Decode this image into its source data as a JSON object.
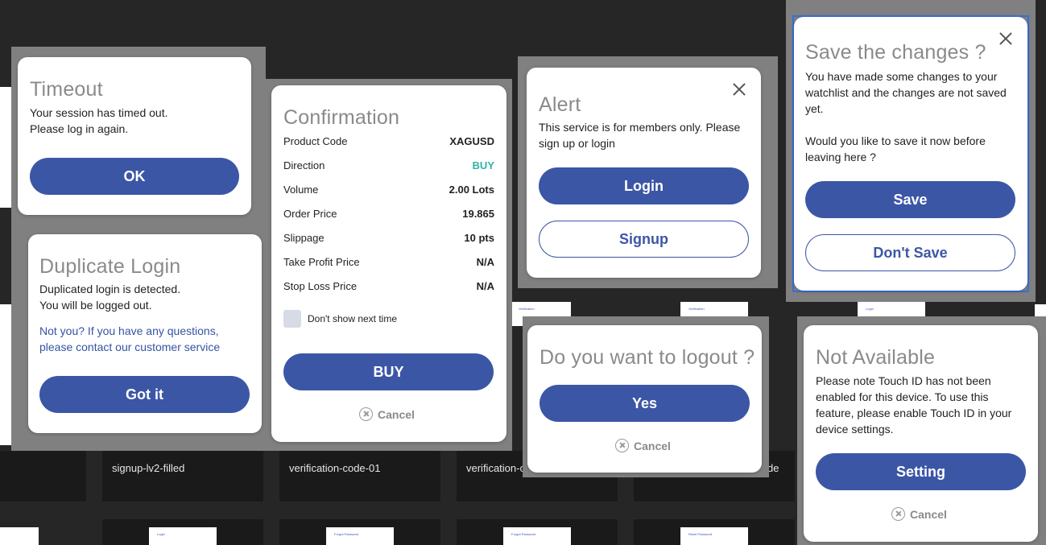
{
  "canvas": {
    "thumb_labels": [
      "signup-lv2-filled",
      "verification-code-01",
      "verification-c",
      "de"
    ],
    "mini_labels": [
      "Login",
      "Forgot Password",
      "Forgot Password",
      "Reset Password",
      "Verification",
      "Verification",
      "Login"
    ]
  },
  "timeout": {
    "title": "Timeout",
    "line1": "Your session has timed out.",
    "line2": "Please log in again.",
    "ok": "OK"
  },
  "duplicate": {
    "title": "Duplicate Login",
    "line1": "Duplicated login is detected.",
    "line2": "You will be logged out.",
    "link1": "Not you? If you have any questions,",
    "link2": "please contact our customer service",
    "button": "Got it"
  },
  "confirmation": {
    "title": "Confirmation",
    "rows": [
      {
        "label": "Product Code",
        "value": "XAGUSD"
      },
      {
        "label": "Direction",
        "value": "BUY"
      },
      {
        "label": "Volume",
        "value": "2.00 Lots"
      },
      {
        "label": "Order Price",
        "value": "19.865"
      },
      {
        "label": "Slippage",
        "value": "10 pts"
      },
      {
        "label": "Take Profit Price",
        "value": "N/A"
      },
      {
        "label": "Stop Loss Price",
        "value": "N/A"
      }
    ],
    "checkbox_label": "Don't show next time",
    "buy": "BUY",
    "cancel": "Cancel",
    "colors": {
      "buy": "#2bb5a6"
    }
  },
  "alert": {
    "title": "Alert",
    "line1": "This service is for members only. Please",
    "line2": "sign up or login",
    "login": "Login",
    "signup": "Signup"
  },
  "logout": {
    "title": "Do you want to logout ?",
    "yes": "Yes",
    "cancel": "Cancel"
  },
  "save": {
    "title": "Save the changes ?",
    "line1": "You have made some changes to your",
    "line2": "watchlist and the changes are not saved",
    "line3": "yet.",
    "line4": "Would you like to save it now before",
    "line5": "leaving here ?",
    "save": "Save",
    "dont_save": "Don't Save"
  },
  "not_available": {
    "title": "Not Available",
    "line1": "Please note Touch ID has not been",
    "line2": "enabled for this device. To use this",
    "line3": "feature, please enable Touch ID in your",
    "line4": "device settings.",
    "setting": "Setting",
    "cancel": "Cancel"
  },
  "colors": {
    "primary": "#3c56a6",
    "title_gray": "#8a8a8a",
    "link": "#3453a4"
  }
}
